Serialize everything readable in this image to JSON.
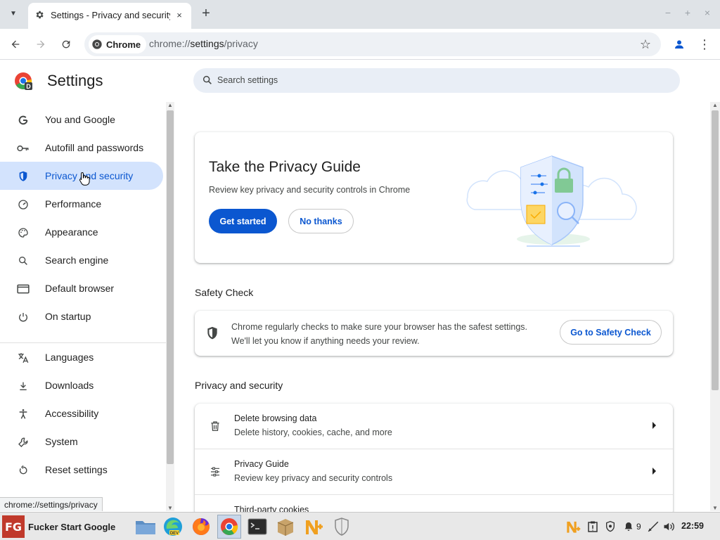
{
  "browser": {
    "tab_title": "Settings - Privacy and security",
    "tab_close": "×",
    "new_tab": "+",
    "window_controls": {
      "minimize": "−",
      "maximize": "+",
      "close": "×"
    },
    "chip_label": "Chrome",
    "url_prefix": "chrome://",
    "url_host": "settings",
    "url_path": "/privacy"
  },
  "settings": {
    "title": "Settings",
    "search_placeholder": "Search settings"
  },
  "sidebar": {
    "items": [
      {
        "label": "You and Google",
        "icon": "google-g-icon"
      },
      {
        "label": "Autofill and passwords",
        "icon": "key-icon"
      },
      {
        "label": "Privacy and security",
        "icon": "shield-icon",
        "active": true
      },
      {
        "label": "Performance",
        "icon": "gauge-icon"
      },
      {
        "label": "Appearance",
        "icon": "palette-icon"
      },
      {
        "label": "Search engine",
        "icon": "search-icon"
      },
      {
        "label": "Default browser",
        "icon": "browser-window-icon"
      },
      {
        "label": "On startup",
        "icon": "power-icon"
      },
      {
        "label": "Languages",
        "icon": "translate-icon"
      },
      {
        "label": "Downloads",
        "icon": "download-icon"
      },
      {
        "label": "Accessibility",
        "icon": "accessibility-icon"
      },
      {
        "label": "System",
        "icon": "wrench-icon"
      },
      {
        "label": "Reset settings",
        "icon": "reset-icon"
      }
    ]
  },
  "privacy_guide": {
    "title": "Take the Privacy Guide",
    "description": "Review key privacy and security controls in Chrome",
    "primary_button": "Get started",
    "secondary_button": "No thanks"
  },
  "safety_check": {
    "heading": "Safety Check",
    "line1": "Chrome regularly checks to make sure your browser has the safest settings.",
    "line2": "We'll let you know if anything needs your review.",
    "button": "Go to Safety Check"
  },
  "privacy_section": {
    "heading": "Privacy and security",
    "rows": [
      {
        "title": "Delete browsing data",
        "subtitle": "Delete history, cookies, cache, and more",
        "icon": "trash-icon"
      },
      {
        "title": "Privacy Guide",
        "subtitle": "Review key privacy and security controls",
        "icon": "tune-icon"
      },
      {
        "title": "Third-party cookies",
        "subtitle": "",
        "icon": "cookie-icon"
      }
    ]
  },
  "status_url": "chrome://settings/privacy",
  "taskbar": {
    "start_logo": "FG",
    "start_label": "Fucker Start Google",
    "tray_notifications": "9",
    "clock": "22:59"
  }
}
